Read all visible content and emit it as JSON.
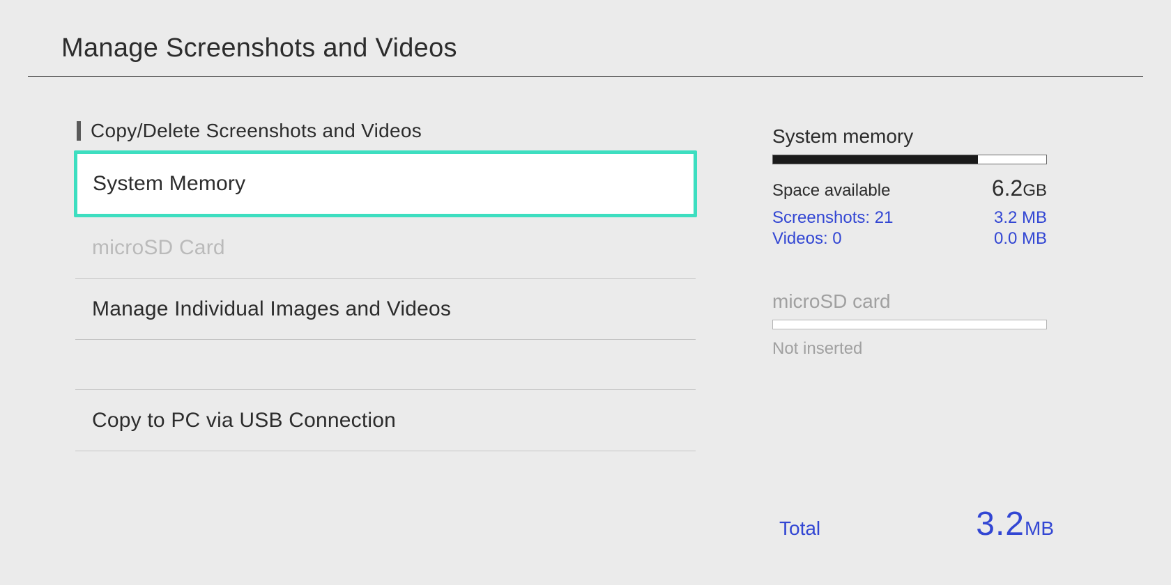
{
  "header": {
    "title": "Manage Screenshots and Videos"
  },
  "section": {
    "title": "Copy/Delete Screenshots and Videos"
  },
  "menu": {
    "system_memory": "System Memory",
    "microsd": "microSD Card",
    "manage_individual": "Manage Individual Images and Videos",
    "copy_to_pc": "Copy to PC via USB Connection"
  },
  "storage": {
    "system": {
      "title": "System memory",
      "fill_percent": 75,
      "space_available_label": "Space available",
      "space_available_value": "6.2",
      "space_available_unit": "GB",
      "screenshots_label": "Screenshots: 21",
      "screenshots_size": "3.2 MB",
      "videos_label": "Videos: 0",
      "videos_size": "0.0 MB"
    },
    "sd": {
      "title": "microSD card",
      "status": "Not inserted"
    },
    "total": {
      "label": "Total",
      "value": "3.2",
      "unit": "MB"
    }
  }
}
